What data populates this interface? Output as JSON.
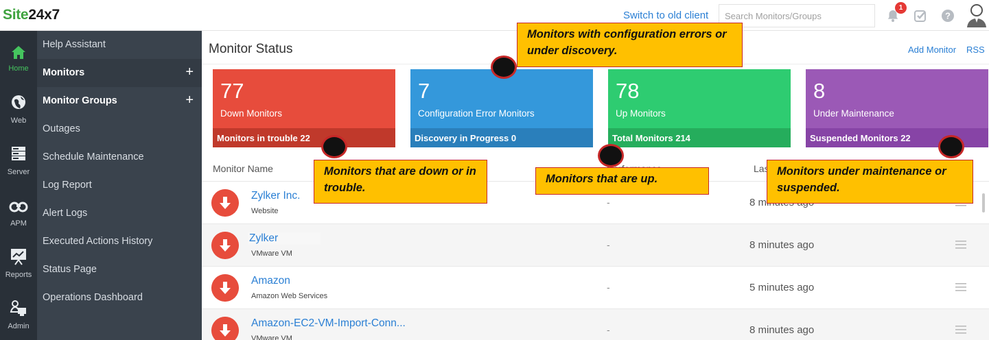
{
  "app": {
    "logo_prefix": "Site",
    "logo_suffix": "24x7",
    "switch_link": "Switch to old client",
    "search_placeholder": "Search Monitors/Groups",
    "notification_count": "1"
  },
  "rail": [
    {
      "label": "Home",
      "icon": "home-icon",
      "active": true
    },
    {
      "label": "Web",
      "icon": "globe-icon"
    },
    {
      "label": "Server",
      "icon": "server-icon"
    },
    {
      "label": "APM",
      "icon": "binoculars-icon"
    },
    {
      "label": "Reports",
      "icon": "chart-icon"
    },
    {
      "label": "Admin",
      "icon": "admin-icon"
    }
  ],
  "nav": [
    {
      "label": "Help Assistant"
    },
    {
      "label": "Monitors",
      "plus": "+"
    },
    {
      "label": "Monitor Groups",
      "plus": "+"
    },
    {
      "label": "Outages"
    },
    {
      "label": "Schedule Maintenance"
    },
    {
      "label": "Log Report"
    },
    {
      "label": "Alert Logs"
    },
    {
      "label": "Executed Actions History"
    },
    {
      "label": "Status Page"
    },
    {
      "label": "Operations Dashboard"
    }
  ],
  "main": {
    "title": "Monitor Status",
    "add_monitor": "Add Monitor",
    "rss": "RSS"
  },
  "cards": [
    {
      "count": "77",
      "label": "Down Monitors",
      "foot_label": "Monitors in trouble",
      "foot_count": "22"
    },
    {
      "count": "7",
      "label": "Configuration Error Monitors",
      "foot_label": "Discovery in Progress",
      "foot_count": "0"
    },
    {
      "count": "78",
      "label": "Up Monitors",
      "foot_label": "Total Monitors",
      "foot_count": "214"
    },
    {
      "count": "8",
      "label": "Under Maintenance",
      "foot_label": "Suspended Monitors",
      "foot_count": "22"
    }
  ],
  "table": {
    "headers": {
      "name": "Monitor Name",
      "performance": "Performance",
      "last": "Last"
    },
    "rows": [
      {
        "name": "Zylker Inc.",
        "type": "Website",
        "perf": "-",
        "last": "8 minutes ago"
      },
      {
        "name": "Zylker",
        "type": "VMware VM",
        "perf": "-",
        "last": "8 minutes ago"
      },
      {
        "name": "Amazon",
        "type": "Amazon Web Services",
        "perf": "-",
        "last": "5 minutes ago"
      },
      {
        "name": "Amazon-EC2-VM-Import-Conn...",
        "type": "VMware VM",
        "perf": "-",
        "last": "8 minutes ago"
      }
    ]
  },
  "annotations": {
    "config": "Monitors with configuration errors or under discovery.",
    "down": "Monitors that are down or in trouble.",
    "up": "Monitors that are up.",
    "maintenance": "Monitors under maintenance or suspended."
  },
  "colors": {
    "down": "#e74c3c",
    "config": "#3498db",
    "up": "#2ecc71",
    "maintenance": "#9b59b6",
    "callout": "#ffc000",
    "link": "#2a7fd4"
  }
}
